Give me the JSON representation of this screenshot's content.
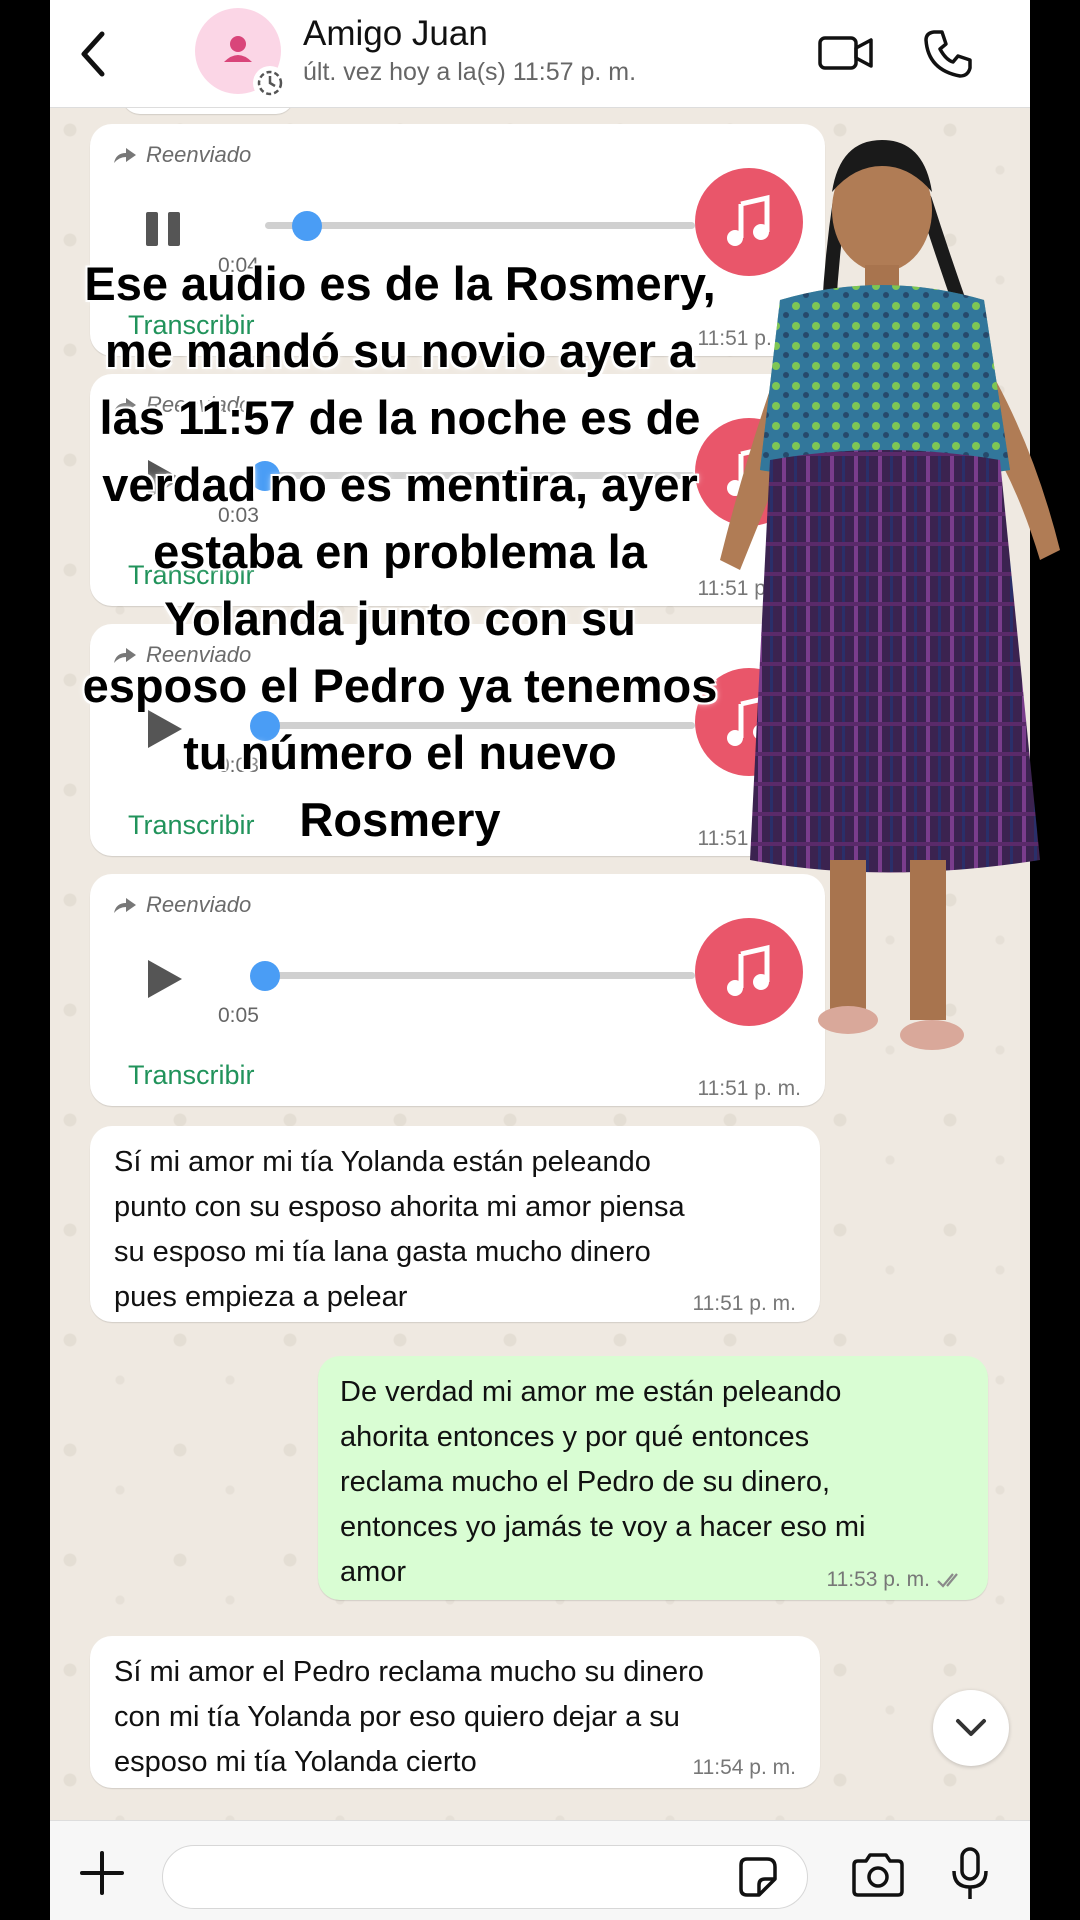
{
  "header": {
    "contact_name": "Amigo Juan",
    "last_seen": "últ. vez hoy a la(s) 11:57 p. m."
  },
  "audio_messages": [
    {
      "forwarded_label": "Reenviado",
      "duration": "0:04",
      "transcribe_label": "Transcribir",
      "time": "11:51 p. m.",
      "state": "playing",
      "progress": 0.1
    },
    {
      "forwarded_label": "Reenviado",
      "duration": "0:03",
      "transcribe_label": "Transcribir",
      "time": "11:51 p. m.",
      "state": "paused",
      "progress": 0.0
    },
    {
      "forwarded_label": "Reenviado",
      "duration": "0:03",
      "transcribe_label": "Transcribir",
      "time": "11:51 p. m.",
      "state": "paused",
      "progress": 0.0
    },
    {
      "forwarded_label": "Reenviado",
      "duration": "0:05",
      "transcribe_label": "Transcribir",
      "time": "11:51 p. m.",
      "state": "paused",
      "progress": 0.0
    }
  ],
  "text_messages": [
    {
      "direction": "in",
      "lines": [
        "Sí mi amor mi tía Yolanda están peleando",
        "punto con su esposo ahorita mi amor piensa",
        "su esposo mi tía lana gasta mucho dinero",
        "pues empieza a pelear"
      ],
      "time": "11:51 p. m."
    },
    {
      "direction": "out",
      "lines": [
        "De verdad mi amor me están peleando",
        "ahorita entonces y por qué entonces",
        "reclama mucho el Pedro de su dinero,",
        "entonces yo jamás te voy a hacer eso mi",
        "amor"
      ],
      "time": "11:53 p. m.",
      "read": true
    },
    {
      "direction": "in",
      "lines": [
        "Sí mi amor el Pedro reclama mucho su dinero",
        "con mi tía Yolanda por eso quiero dejar a su",
        "esposo mi tía Yolanda cierto"
      ],
      "time": "11:54 p. m."
    }
  ],
  "caption": {
    "lines": [
      "Ese audio es de la Rosmery,",
      "me mandó su novio ayer a",
      "las 11:57 de la noche es de",
      "verdad no es mentira, ayer",
      "estaba en problema la",
      "Yolanda junto con su",
      "esposo el Pedro ya tenemos",
      "tu número el nuevo",
      "Rosmery"
    ]
  },
  "composer": {
    "placeholder": ""
  },
  "colors": {
    "outgoing": "#d9fdd3",
    "incoming": "#ffffff",
    "accent": "#21935b",
    "music": "#e9566a",
    "knob": "#4a9df5"
  }
}
